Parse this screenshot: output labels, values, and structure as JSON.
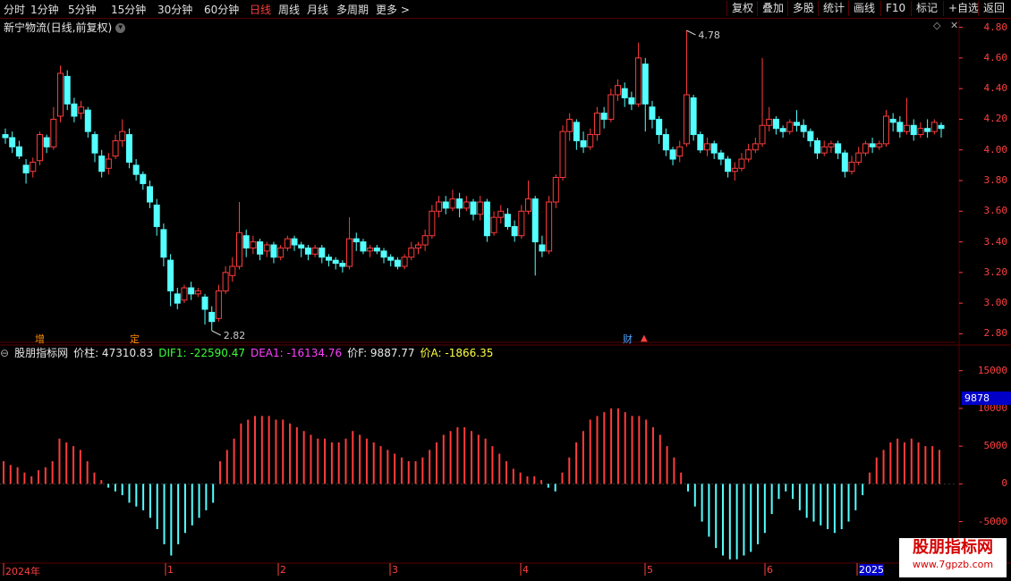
{
  "toolbar": {
    "periods": [
      {
        "label": "分时",
        "active": false
      },
      {
        "label": "1分钟",
        "active": false
      },
      {
        "label": "5分钟",
        "active": false
      },
      {
        "label": "15分钟",
        "active": false
      },
      {
        "label": "30分钟",
        "active": false
      },
      {
        "label": "60分钟",
        "active": false
      },
      {
        "label": "日线",
        "active": true
      },
      {
        "label": "周线",
        "active": false
      },
      {
        "label": "月线",
        "active": false
      },
      {
        "label": "多周期",
        "active": false
      },
      {
        "label": "更多 >",
        "active": false
      }
    ],
    "actions": [
      "复权",
      "叠加",
      "多股",
      "统计",
      "画线",
      "F10",
      "标记",
      "+自选",
      "返回"
    ]
  },
  "stock_title": "新宁物流(日线,前复权)",
  "price_axis": [
    "4.80",
    "4.60",
    "4.40",
    "4.20",
    "4.00",
    "3.80",
    "3.60",
    "3.40",
    "3.20",
    "3.00",
    "2.80"
  ],
  "annotations": {
    "high": "4.78",
    "low": "2.82"
  },
  "events": [
    {
      "label": "增",
      "color": "#ff8c00"
    },
    {
      "label": "定",
      "color": "#ff8c00"
    },
    {
      "label": "财",
      "color": "#4aa3ff"
    }
  ],
  "indicator": {
    "name": "股朋指标网",
    "items": [
      {
        "text": "价柱: 47310.83",
        "color": "#e8e8e8"
      },
      {
        "text": "DIF1: -22590.47",
        "color": "#3cff3c"
      },
      {
        "text": "DEA1: -16134.76",
        "color": "#ff40ff"
      },
      {
        "text": "价F: 9887.77",
        "color": "#e8e8e8"
      },
      {
        "text": "价A: -1866.35",
        "color": "#ffff40"
      }
    ],
    "axis": [
      "15000",
      "10000",
      "5000",
      "0",
      "-5000"
    ],
    "badge": "9878"
  },
  "dates": [
    "2024年",
    "1",
    "2",
    "3",
    "4",
    "5",
    "6",
    "2025"
  ],
  "watermark": {
    "line1": "股朋指标网",
    "line2": "www.7gpzb.com"
  },
  "colors": {
    "up": "#ff3c3c",
    "down": "#54ffff",
    "grid": "#5a0000"
  },
  "chart_data": {
    "type": "candlestick",
    "y_range": [
      2.75,
      4.85
    ],
    "candles": [
      [
        4.1,
        4.08,
        4.14,
        4.04
      ],
      [
        4.08,
        4.02,
        4.12,
        3.98
      ],
      [
        4.02,
        3.96,
        4.06,
        3.94
      ],
      [
        3.9,
        3.85,
        3.94,
        3.78
      ],
      [
        3.86,
        3.92,
        3.95,
        3.82
      ],
      [
        3.93,
        4.1,
        4.12,
        3.9
      ],
      [
        4.08,
        4.02,
        4.1,
        3.98
      ],
      [
        4.02,
        4.2,
        4.28,
        4.0
      ],
      [
        4.22,
        4.5,
        4.55,
        4.18
      ],
      [
        4.48,
        4.3,
        4.52,
        4.26
      ],
      [
        4.3,
        4.22,
        4.34,
        4.18
      ],
      [
        4.24,
        4.28,
        4.32,
        4.2
      ],
      [
        4.26,
        4.12,
        4.28,
        4.08
      ],
      [
        4.1,
        3.98,
        4.12,
        3.92
      ],
      [
        3.96,
        3.86,
        4.0,
        3.82
      ],
      [
        3.88,
        3.94,
        3.98,
        3.84
      ],
      [
        3.96,
        4.06,
        4.1,
        3.94
      ],
      [
        4.06,
        4.12,
        4.2,
        4.02
      ],
      [
        4.1,
        3.92,
        4.14,
        3.88
      ],
      [
        3.9,
        3.84,
        3.94,
        3.8
      ],
      [
        3.84,
        3.78,
        3.86,
        3.74
      ],
      [
        3.76,
        3.66,
        3.8,
        3.62
      ],
      [
        3.64,
        3.5,
        3.68,
        3.44
      ],
      [
        3.48,
        3.3,
        3.52,
        3.24
      ],
      [
        3.28,
        3.08,
        3.32,
        2.98
      ],
      [
        3.06,
        3.0,
        3.1,
        2.96
      ],
      [
        3.02,
        3.1,
        3.12,
        3.0
      ],
      [
        3.1,
        3.06,
        3.14,
        3.02
      ],
      [
        3.06,
        3.08,
        3.1,
        3.04
      ],
      [
        3.04,
        2.96,
        3.06,
        2.86
      ],
      [
        2.94,
        2.88,
        2.98,
        2.82
      ],
      [
        2.9,
        3.08,
        3.12,
        2.88
      ],
      [
        3.08,
        3.2,
        3.24,
        3.06
      ],
      [
        3.18,
        3.24,
        3.3,
        3.14
      ],
      [
        3.24,
        3.46,
        3.66,
        3.22
      ],
      [
        3.44,
        3.36,
        3.48,
        3.3
      ],
      [
        3.36,
        3.4,
        3.44,
        3.32
      ],
      [
        3.4,
        3.32,
        3.42,
        3.28
      ],
      [
        3.34,
        3.38,
        3.4,
        3.3
      ],
      [
        3.38,
        3.3,
        3.4,
        3.26
      ],
      [
        3.3,
        3.36,
        3.38,
        3.28
      ],
      [
        3.36,
        3.42,
        3.44,
        3.34
      ],
      [
        3.42,
        3.38,
        3.44,
        3.34
      ],
      [
        3.38,
        3.36,
        3.4,
        3.3
      ],
      [
        3.36,
        3.32,
        3.38,
        3.28
      ],
      [
        3.32,
        3.36,
        3.38,
        3.3
      ],
      [
        3.36,
        3.3,
        3.38,
        3.26
      ],
      [
        3.3,
        3.28,
        3.32,
        3.24
      ],
      [
        3.28,
        3.26,
        3.3,
        3.22
      ],
      [
        3.26,
        3.24,
        3.28,
        3.2
      ],
      [
        3.24,
        3.42,
        3.56,
        3.22
      ],
      [
        3.42,
        3.4,
        3.46,
        3.34
      ],
      [
        3.4,
        3.34,
        3.42,
        3.32
      ],
      [
        3.34,
        3.36,
        3.38,
        3.3
      ],
      [
        3.36,
        3.34,
        3.38,
        3.32
      ],
      [
        3.34,
        3.3,
        3.36,
        3.26
      ],
      [
        3.3,
        3.28,
        3.32,
        3.24
      ],
      [
        3.28,
        3.24,
        3.3,
        3.22
      ],
      [
        3.24,
        3.3,
        3.32,
        3.22
      ],
      [
        3.3,
        3.36,
        3.4,
        3.28
      ],
      [
        3.36,
        3.38,
        3.4,
        3.32
      ],
      [
        3.38,
        3.44,
        3.48,
        3.34
      ],
      [
        3.44,
        3.6,
        3.64,
        3.42
      ],
      [
        3.6,
        3.66,
        3.7,
        3.56
      ],
      [
        3.66,
        3.62,
        3.7,
        3.58
      ],
      [
        3.62,
        3.68,
        3.74,
        3.6
      ],
      [
        3.68,
        3.62,
        3.72,
        3.56
      ],
      [
        3.62,
        3.66,
        3.7,
        3.6
      ],
      [
        3.66,
        3.58,
        3.68,
        3.54
      ],
      [
        3.58,
        3.66,
        3.7,
        3.54
      ],
      [
        3.66,
        3.44,
        3.68,
        3.4
      ],
      [
        3.46,
        3.56,
        3.6,
        3.44
      ],
      [
        3.56,
        3.6,
        3.64,
        3.52
      ],
      [
        3.58,
        3.5,
        3.62,
        3.48
      ],
      [
        3.5,
        3.44,
        3.54,
        3.4
      ],
      [
        3.44,
        3.6,
        3.64,
        3.42
      ],
      [
        3.6,
        3.68,
        3.8,
        3.58
      ],
      [
        3.68,
        3.4,
        3.7,
        3.18
      ],
      [
        3.38,
        3.34,
        3.44,
        3.3
      ],
      [
        3.34,
        3.66,
        3.7,
        3.32
      ],
      [
        3.66,
        3.82,
        3.84,
        3.62
      ],
      [
        3.82,
        4.12,
        4.16,
        3.8
      ],
      [
        4.12,
        4.2,
        4.24,
        4.06
      ],
      [
        4.18,
        4.06,
        4.2,
        4.0
      ],
      [
        4.06,
        4.02,
        4.12,
        3.98
      ],
      [
        4.02,
        4.1,
        4.14,
        4.0
      ],
      [
        4.1,
        4.24,
        4.28,
        4.06
      ],
      [
        4.24,
        4.2,
        4.28,
        4.14
      ],
      [
        4.2,
        4.36,
        4.4,
        4.18
      ],
      [
        4.36,
        4.42,
        4.46,
        4.32
      ],
      [
        4.4,
        4.34,
        4.44,
        4.28
      ],
      [
        4.34,
        4.3,
        4.38,
        4.26
      ],
      [
        4.3,
        4.6,
        4.7,
        4.28
      ],
      [
        4.56,
        4.3,
        4.6,
        4.12
      ],
      [
        4.28,
        4.2,
        4.32,
        4.14
      ],
      [
        4.2,
        4.1,
        4.22,
        4.04
      ],
      [
        4.1,
        4.0,
        4.14,
        3.96
      ],
      [
        4.0,
        3.94,
        4.02,
        3.9
      ],
      [
        3.96,
        4.02,
        4.06,
        3.92
      ],
      [
        4.04,
        4.36,
        4.78,
        4.02
      ],
      [
        4.34,
        4.1,
        4.36,
        4.06
      ],
      [
        4.1,
        4.0,
        4.12,
        3.98
      ],
      [
        4.0,
        4.04,
        4.08,
        3.96
      ],
      [
        4.04,
        3.98,
        4.06,
        3.94
      ],
      [
        3.98,
        3.94,
        4.0,
        3.9
      ],
      [
        3.94,
        3.86,
        3.96,
        3.82
      ],
      [
        3.86,
        3.88,
        3.92,
        3.8
      ],
      [
        3.88,
        3.94,
        3.98,
        3.86
      ],
      [
        3.94,
        4.0,
        4.04,
        3.92
      ],
      [
        4.0,
        4.04,
        4.08,
        3.98
      ],
      [
        4.04,
        4.16,
        4.6,
        4.02
      ],
      [
        4.16,
        4.2,
        4.28,
        4.12
      ],
      [
        4.2,
        4.14,
        4.22,
        4.1
      ],
      [
        4.14,
        4.12,
        4.16,
        4.08
      ],
      [
        4.12,
        4.18,
        4.2,
        4.1
      ],
      [
        4.18,
        4.16,
        4.26,
        4.12
      ],
      [
        4.16,
        4.12,
        4.2,
        4.08
      ],
      [
        4.12,
        4.06,
        4.14,
        4.02
      ],
      [
        4.06,
        3.98,
        4.08,
        3.94
      ],
      [
        3.98,
        4.02,
        4.06,
        3.96
      ],
      [
        4.02,
        4.04,
        4.06,
        3.98
      ],
      [
        4.04,
        3.98,
        4.06,
        3.94
      ],
      [
        3.98,
        3.86,
        4.0,
        3.82
      ],
      [
        3.86,
        3.92,
        3.96,
        3.84
      ],
      [
        3.92,
        3.98,
        4.02,
        3.9
      ],
      [
        3.98,
        4.04,
        4.06,
        3.96
      ],
      [
        4.04,
        4.02,
        4.08,
        3.98
      ],
      [
        4.02,
        4.04,
        4.06,
        4.0
      ],
      [
        4.04,
        4.22,
        4.26,
        4.02
      ],
      [
        4.2,
        4.18,
        4.24,
        4.12
      ],
      [
        4.18,
        4.12,
        4.22,
        4.08
      ],
      [
        4.12,
        4.16,
        4.34,
        4.1
      ],
      [
        4.16,
        4.1,
        4.2,
        4.06
      ],
      [
        4.1,
        4.14,
        4.18,
        4.08
      ],
      [
        4.14,
        4.12,
        4.2,
        4.08
      ],
      [
        4.12,
        4.18,
        4.2,
        4.1
      ],
      [
        4.16,
        4.14,
        4.18,
        4.08
      ]
    ],
    "macd_hist": [
      3000,
      2500,
      2200,
      1500,
      1000,
      1800,
      2200,
      3000,
      6000,
      5500,
      5000,
      4500,
      3000,
      1500,
      500,
      -500,
      -1000,
      -1500,
      -2500,
      -3000,
      -3500,
      -4500,
      -6000,
      -8000,
      -9500,
      -8000,
      -6500,
      -5500,
      -4500,
      -3500,
      -2500,
      3000,
      4500,
      6000,
      8000,
      8500,
      9000,
      9000,
      9000,
      8500,
      8500,
      8000,
      7500,
      7000,
      6500,
      6000,
      6000,
      5500,
      5500,
      6000,
      7000,
      6500,
      6000,
      5500,
      5000,
      4500,
      4000,
      3500,
      3000,
      3000,
      3500,
      4500,
      5500,
      6500,
      7000,
      7500,
      7500,
      7000,
      6500,
      6000,
      5000,
      4000,
      3000,
      2000,
      1500,
      1000,
      1000,
      500,
      -500,
      -1000,
      1500,
      3500,
      5500,
      7000,
      8500,
      9000,
      9500,
      10000,
      10000,
      9500,
      9000,
      9000,
      8500,
      7500,
      6500,
      5000,
      3500,
      1500,
      -1000,
      -3000,
      -5000,
      -7000,
      -8500,
      -9500,
      -10000,
      -10000,
      -9500,
      -9000,
      -8000,
      -6500,
      -4000,
      -2000,
      -1000,
      -2000,
      -3500,
      -4500,
      -5000,
      -5500,
      -6000,
      -6500,
      -6000,
      -5000,
      -3500,
      -1500,
      1500,
      3500,
      4500,
      5500,
      6000,
      5500,
      6000,
      5500,
      5000,
      5000,
      4500
    ],
    "macd_axis_range": [
      -10500,
      16500
    ]
  }
}
